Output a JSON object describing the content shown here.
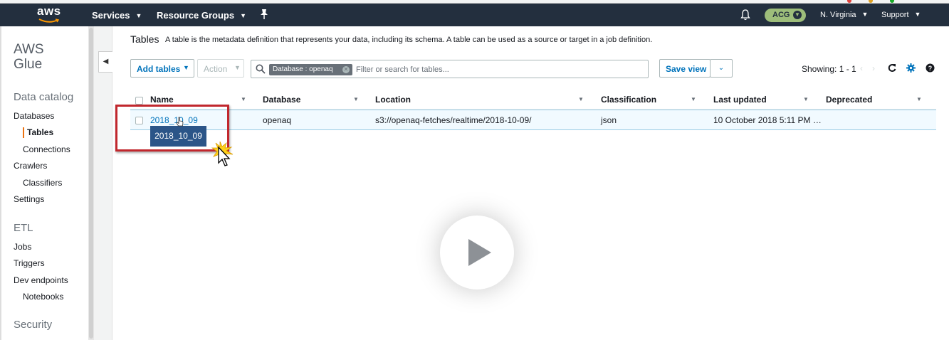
{
  "navbar": {
    "logo_text": "aws",
    "services": "Services",
    "resource_groups": "Resource Groups",
    "account_badge": "ACG",
    "region": "N. Virginia",
    "support": "Support"
  },
  "sidebar": {
    "title_line1": "AWS",
    "title_line2": "Glue",
    "data_catalog": "Data catalog",
    "databases": "Databases",
    "tables": "Tables",
    "connections": "Connections",
    "crawlers": "Crawlers",
    "classifiers": "Classifiers",
    "settings": "Settings",
    "etl": "ETL",
    "jobs": "Jobs",
    "triggers": "Triggers",
    "dev_endpoints": "Dev endpoints",
    "notebooks": "Notebooks",
    "security": "Security"
  },
  "main": {
    "title": "Tables",
    "description": "A table is the metadata definition that represents your data, including its schema. A table can be used as a source or target in a job definition."
  },
  "toolbar": {
    "add_tables": "Add tables",
    "action": "Action",
    "filter_token": "Database : openaq",
    "search_placeholder": "Filter or search for tables...",
    "save_view": "Save view",
    "showing": "Showing: 1 - 1"
  },
  "table": {
    "columns": [
      "Name",
      "Database",
      "Location",
      "Classification",
      "Last updated",
      "Deprecated"
    ],
    "rows": [
      {
        "name": "2018_10_09",
        "database": "openaq",
        "location": "s3://openaq-fetches/realtime/2018-10-09/",
        "classification": "json",
        "last_updated": "10 October 2018 5:11 PM …",
        "deprecated": ""
      }
    ]
  },
  "tooltip": "2018_10_09",
  "colors": {
    "navbar": "#232f3e",
    "link": "#0073bb",
    "highlight_box": "#c1272d",
    "tooltip_bg": "#2b5588",
    "account_badge": "#9dbd7a"
  }
}
